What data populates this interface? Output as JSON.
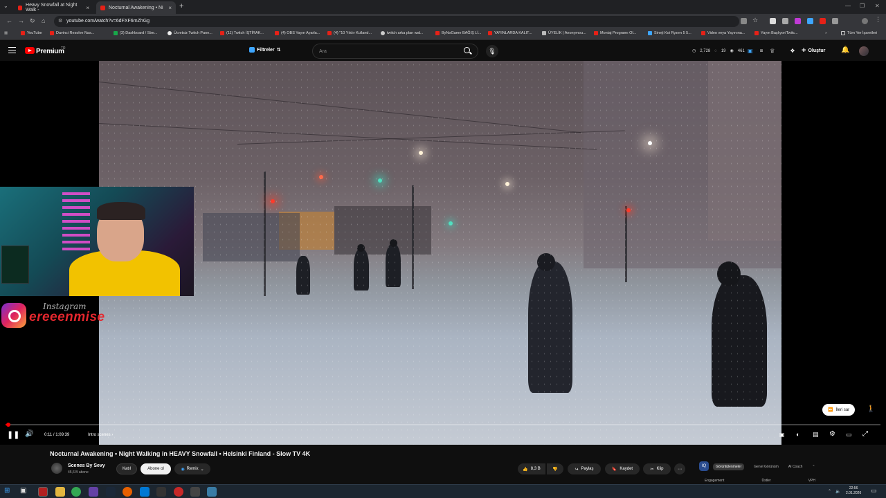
{
  "browser": {
    "tabs": [
      {
        "title": "Heavy Snowfall at Night Walk -",
        "active": false
      },
      {
        "title": "Nocturnal Awakening • Ni",
        "active": true
      }
    ],
    "url": "youtube.com/watch?v=6dFXF6mZhGg",
    "bookmarks": [
      "YouTube",
      "Davinci Resolve Nas...",
      "(3) Dashboard / Stre...",
      "Ücretsiz Twitch Pane...",
      "(11) Twitch İŞTİRAK...",
      "(4) OBS Yayın Ayarla...",
      "(4) \"10 Yıldır Kulland...",
      "twitch arka plan wal...",
      "ByNoGame BAĞIŞ Lİ...",
      "YAYINLARDA KALIT...",
      "ÜYELİK | Anonymou...",
      "Montaj Programı Ol...",
      "Sineji Koi Ryzen 5 5...",
      "Video veya Yayınına...",
      "Yayın Başlıyor/Twitc..."
    ],
    "all_bookmarks": "Tüm Yer İşaretleri"
  },
  "youtube": {
    "brand": "Premium",
    "country": "TR",
    "filters_label": "Filtreler",
    "search_placeholder": "Ara",
    "stats": [
      "2,728",
      "19",
      "461"
    ],
    "create_label": "Oluştur"
  },
  "overlay": {
    "instagram_label": "Instagram",
    "instagram_handle": "ereeenmise"
  },
  "player": {
    "progress_fraction": 0.0028,
    "time": "0:11 / 1:09:39",
    "chapter": "Intro scenes",
    "skip_label": "İleri sar"
  },
  "video": {
    "title": "Nocturnal Awakening • Night Walking in HEAVY Snowfall • Helsinki Finland - Slow TV 4K",
    "channel": "Scenes By Sevy",
    "subscribers": "45,6 B abone",
    "join_label": "Katıl",
    "subscribe_label": "Abone ol",
    "remix_label": "Remix",
    "likes": "8,3 B",
    "share_label": "Paylaş",
    "save_label": "Kaydet",
    "clip_label": "Klip"
  },
  "side_panel": {
    "icon_text": "IQ",
    "tabs": [
      "Görüntülenmeler",
      "Genel Görünüm",
      "AI Coach"
    ],
    "labels": [
      "Engagement",
      "Üstler",
      "VPH"
    ]
  },
  "taskbar": {
    "time": "22:56",
    "date": "2.01.2026"
  },
  "colors": {
    "youtube_red": "#ff0000",
    "accent_blue": "#3ea6ff",
    "background": "#0f0f0f"
  }
}
